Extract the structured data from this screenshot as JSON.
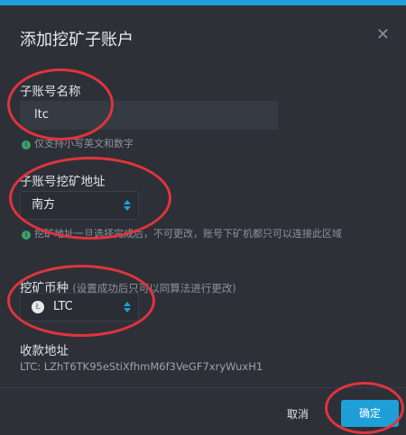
{
  "dialog": {
    "title": "添加挖矿子账户",
    "close_icon": "close-icon"
  },
  "subaccount_name": {
    "label": "子账号名称",
    "value": "ltc",
    "hint": "仅支持小写英文和数字"
  },
  "mining_address": {
    "label": "子账号挖矿地址",
    "selected": "南方",
    "hint": "挖矿地址一旦选择完成后，不可更改，账号下矿机都只可以连接此区域"
  },
  "mining_coin": {
    "label": "挖矿币种",
    "note": "(设置成功后只可以同算法进行更改)",
    "selected": "LTC",
    "icon": "litecoin-icon"
  },
  "receive_address": {
    "label": "收款地址",
    "value": "LTC: LZhT6TK95eStiXfhmM6f3VeGF7xryWuxH1"
  },
  "footer": {
    "cancel_label": "取消",
    "confirm_label": "确定"
  },
  "colors": {
    "accent": "#1e9fd7",
    "annotation": "#e0343d",
    "background": "#2d3037"
  }
}
